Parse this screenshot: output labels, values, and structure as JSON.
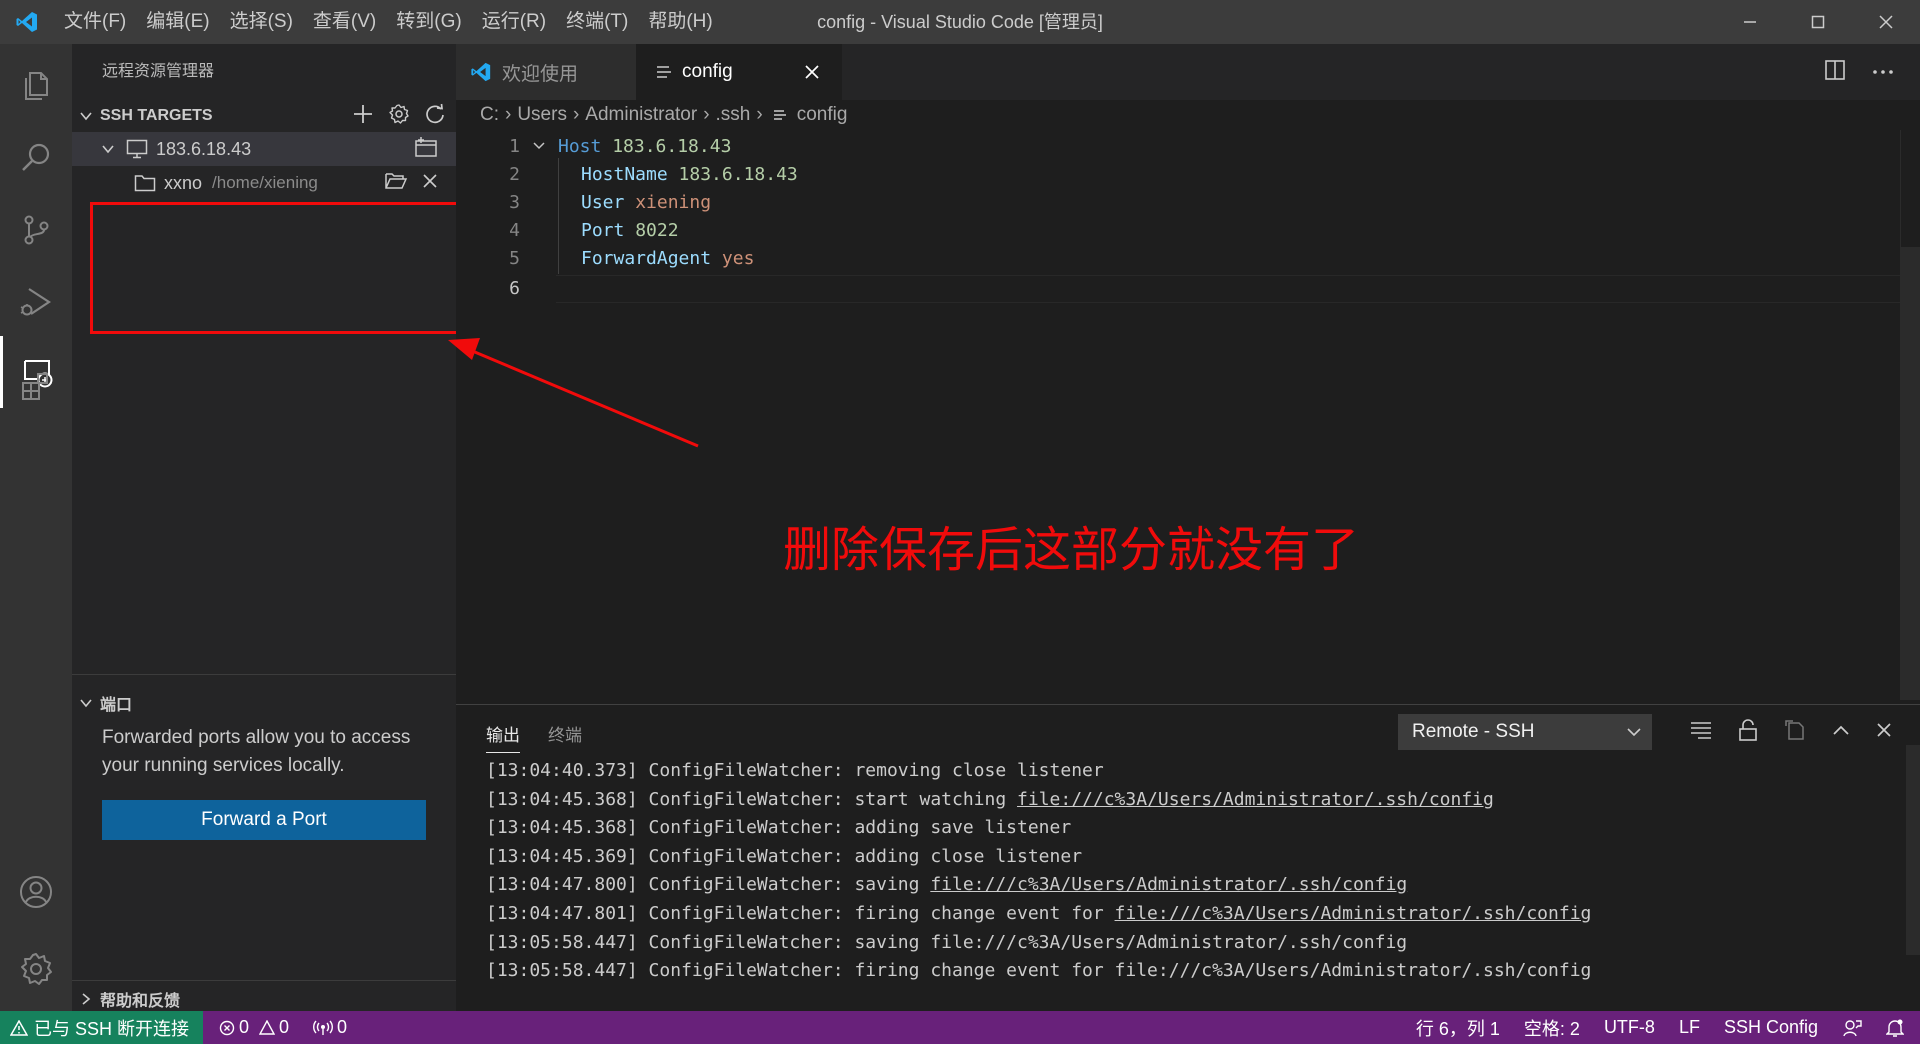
{
  "window": {
    "title": "config - Visual Studio Code [管理员]",
    "menu": [
      "文件(F)",
      "编辑(E)",
      "选择(S)",
      "查看(V)",
      "转到(G)",
      "运行(R)",
      "终端(T)",
      "帮助(H)"
    ]
  },
  "sidebar": {
    "title": "远程资源管理器",
    "ssh_section": "SSH TARGETS",
    "host": "183.6.18.43",
    "folder_name": "xxno",
    "folder_path": "/home/xiening",
    "ports_section": "端口",
    "ports_desc": "Forwarded ports allow you to access your running services locally.",
    "forward_button": "Forward a Port",
    "help_section": "帮助和反馈"
  },
  "tabs": {
    "welcome": "欢迎使用",
    "config": "config"
  },
  "breadcrumb": [
    "C:",
    "Users",
    "Administrator",
    ".ssh",
    "config"
  ],
  "editor": {
    "lines": [
      {
        "n": "1",
        "k": "Host",
        "v": "183.6.18.43"
      },
      {
        "n": "2",
        "k": "HostName",
        "v": "183.6.18.43"
      },
      {
        "n": "3",
        "k": "User",
        "v": "xiening"
      },
      {
        "n": "4",
        "k": "Port",
        "v": "8022"
      },
      {
        "n": "5",
        "k": "ForwardAgent",
        "v": "yes"
      },
      {
        "n": "6",
        "k": "",
        "v": ""
      }
    ]
  },
  "annotation": "删除保存后这部分就没有了",
  "panel": {
    "tab_output": "输出",
    "tab_terminal": "终端",
    "channel": "Remote - SSH",
    "log": [
      {
        "t": "[13:04:40.373] ConfigFileWatcher: removing close listener",
        "link": ""
      },
      {
        "t": "[13:04:45.368] ConfigFileWatcher: start watching ",
        "link": "file:///c%3A/Users/Administrator/.ssh/config"
      },
      {
        "t": "[13:04:45.368] ConfigFileWatcher: adding save listener",
        "link": ""
      },
      {
        "t": "[13:04:45.369] ConfigFileWatcher: adding close listener",
        "link": ""
      },
      {
        "t": "[13:04:47.800] ConfigFileWatcher: saving ",
        "link": "file:///c%3A/Users/Administrator/.ssh/config"
      },
      {
        "t": "[13:04:47.801] ConfigFileWatcher: firing change event for ",
        "link": "file:///c%3A/Users/Administrator/.ssh/config"
      },
      {
        "t": "[13:05:58.447] ConfigFileWatcher: saving file:///c%3A/Users/Administrator/.ssh/config",
        "link": ""
      },
      {
        "t": "[13:05:58.447] ConfigFileWatcher: firing change event for file:///c%3A/Users/Administrator/.ssh/config",
        "link": ""
      }
    ]
  },
  "statusbar": {
    "remote": "已与 SSH 断开连接",
    "errors": "0",
    "warnings": "0",
    "ports": "0",
    "position": "行 6，列 1",
    "spaces": "空格: 2",
    "encoding": "UTF-8",
    "eol": "LF",
    "language": "SSH Config"
  },
  "colors": {
    "statusbar": "#68217a",
    "remote_indicator": "#16825d",
    "annotation": "#f10b0b",
    "button": "#0e639c"
  }
}
